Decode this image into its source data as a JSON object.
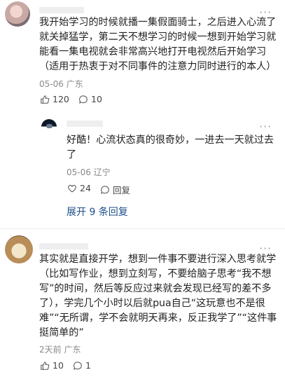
{
  "comments": [
    {
      "lines": [
        "我开始学习的时候就播一集假面骑士，之后进入心流了",
        "就关掉猛学，第二天不想学习的时候一想到开始学习就",
        "能看一集电视就会非常高兴地打开电视然后开始学习",
        "（适用于热衷于对不同事件的注意力同时进行的本人）"
      ],
      "date": "05-06",
      "location": "广东",
      "likes": "120",
      "replies": "10"
    },
    {
      "lines": [
        "其实就是直接开学，想到一件事不要进行深入思考就学",
        "（比如写作业，想到立刻写，不要给脑子思考“我不想",
        "写”的时间，然后等反应过来就会发现已经写的差不多",
        "了），学完几个小时以后就pua自己“这玩意也不是很",
        "难”“无所谓，学不会就明天再来，反正我学了”“这件事",
        "挺简单的”"
      ],
      "date": "2天前",
      "location": "广东",
      "likes": "10",
      "replies": "1"
    }
  ],
  "reply": {
    "lines": [
      "好酷！心流状态真的很奇妙，一进去一天就过去",
      "了"
    ],
    "date": "05-06",
    "location": "辽宁",
    "likes": "24",
    "reply_label": "回复"
  },
  "expand_label": "展开 9 条回复",
  "more_glyph": "···",
  "icons": {
    "like": "thumbs-up-icon",
    "comment": "comment-bubble-icon",
    "more": "more-options-icon"
  }
}
